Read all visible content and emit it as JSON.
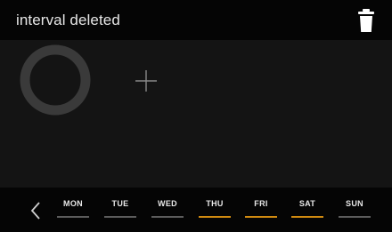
{
  "header": {
    "title": "interval deleted",
    "trash_icon": "trash-icon"
  },
  "main": {
    "ring_icon": "ring-progress-icon",
    "add_icon": "plus-icon"
  },
  "days_bar": {
    "back_icon": "chevron-left-icon",
    "days": [
      {
        "label": "MON",
        "active": false
      },
      {
        "label": "TUE",
        "active": false
      },
      {
        "label": "WED",
        "active": false
      },
      {
        "label": "THU",
        "active": true
      },
      {
        "label": "FRI",
        "active": true
      },
      {
        "label": "SAT",
        "active": true
      },
      {
        "label": "SUN",
        "active": false
      }
    ]
  },
  "colors": {
    "background": "#141414",
    "bar_background": "#050505",
    "text": "#e6e6e6",
    "accent": "#d08a10",
    "inactive_underline": "#5c5c5c",
    "ring": "#3a3a3a"
  }
}
